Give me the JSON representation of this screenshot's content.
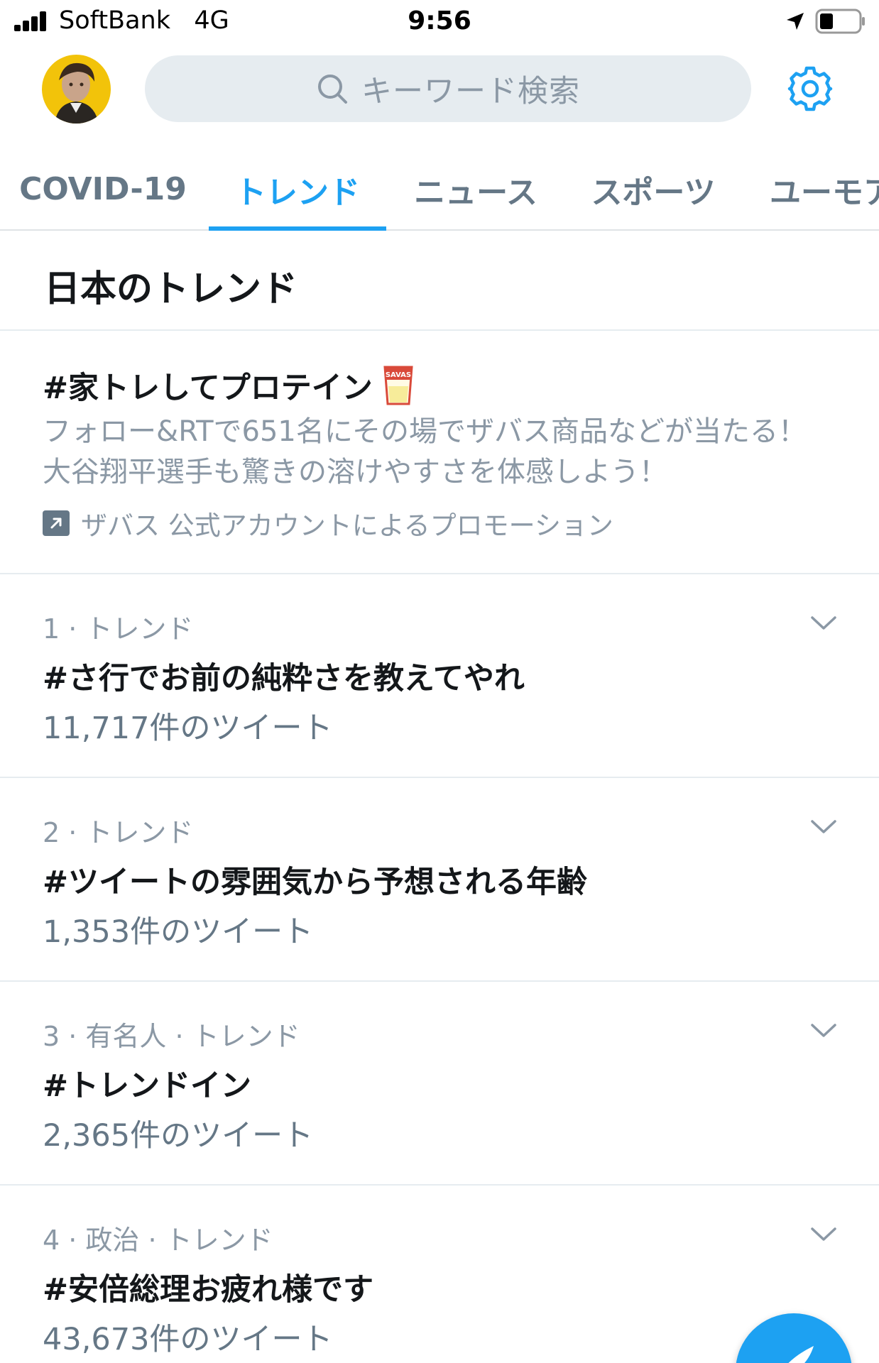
{
  "status_bar": {
    "carrier": "SoftBank",
    "network": "4G",
    "time": "9:56"
  },
  "header": {
    "search_placeholder": "キーワード検索",
    "icons": [
      "avatar",
      "search-icon",
      "gear-icon"
    ]
  },
  "tabs": [
    {
      "label": "COVID-19",
      "active": false
    },
    {
      "label": "トレンド",
      "active": true
    },
    {
      "label": "ニュース",
      "active": false
    },
    {
      "label": "スポーツ",
      "active": false
    },
    {
      "label": "ユーモア",
      "active": false
    }
  ],
  "section": {
    "title": "日本のトレンド"
  },
  "promoted": {
    "title": "#家トレしてプロテイン",
    "description": "フォロー&RTで651名にその場でザバス商品などが当たる！ 大谷翔平選手も驚きの溶けやすさを体感しよう！",
    "promoted_by": "ザバス 公式アカウントによるプロモーション",
    "badge_text": "SAVAS"
  },
  "trends": [
    {
      "meta": "1 · トレンド",
      "name": "#さ行でお前の純粋さを教えてやれ",
      "count": "11,717件のツイート"
    },
    {
      "meta": "2 · トレンド",
      "name": "#ツイートの雰囲気から予想される年齢",
      "count": "1,353件のツイート"
    },
    {
      "meta": "3 · 有名人 · トレンド",
      "name": "#トレンドイン",
      "count": "2,365件のツイート"
    },
    {
      "meta": "4 · 政治 · トレンド",
      "name": "#安倍総理お疲れ様です",
      "count": "43,673件のツイート"
    }
  ],
  "colors": {
    "accent": "#1da1f2",
    "secondary_text": "#8b98a5",
    "muted_text": "#657786",
    "search_bg": "#e6ecf0"
  }
}
